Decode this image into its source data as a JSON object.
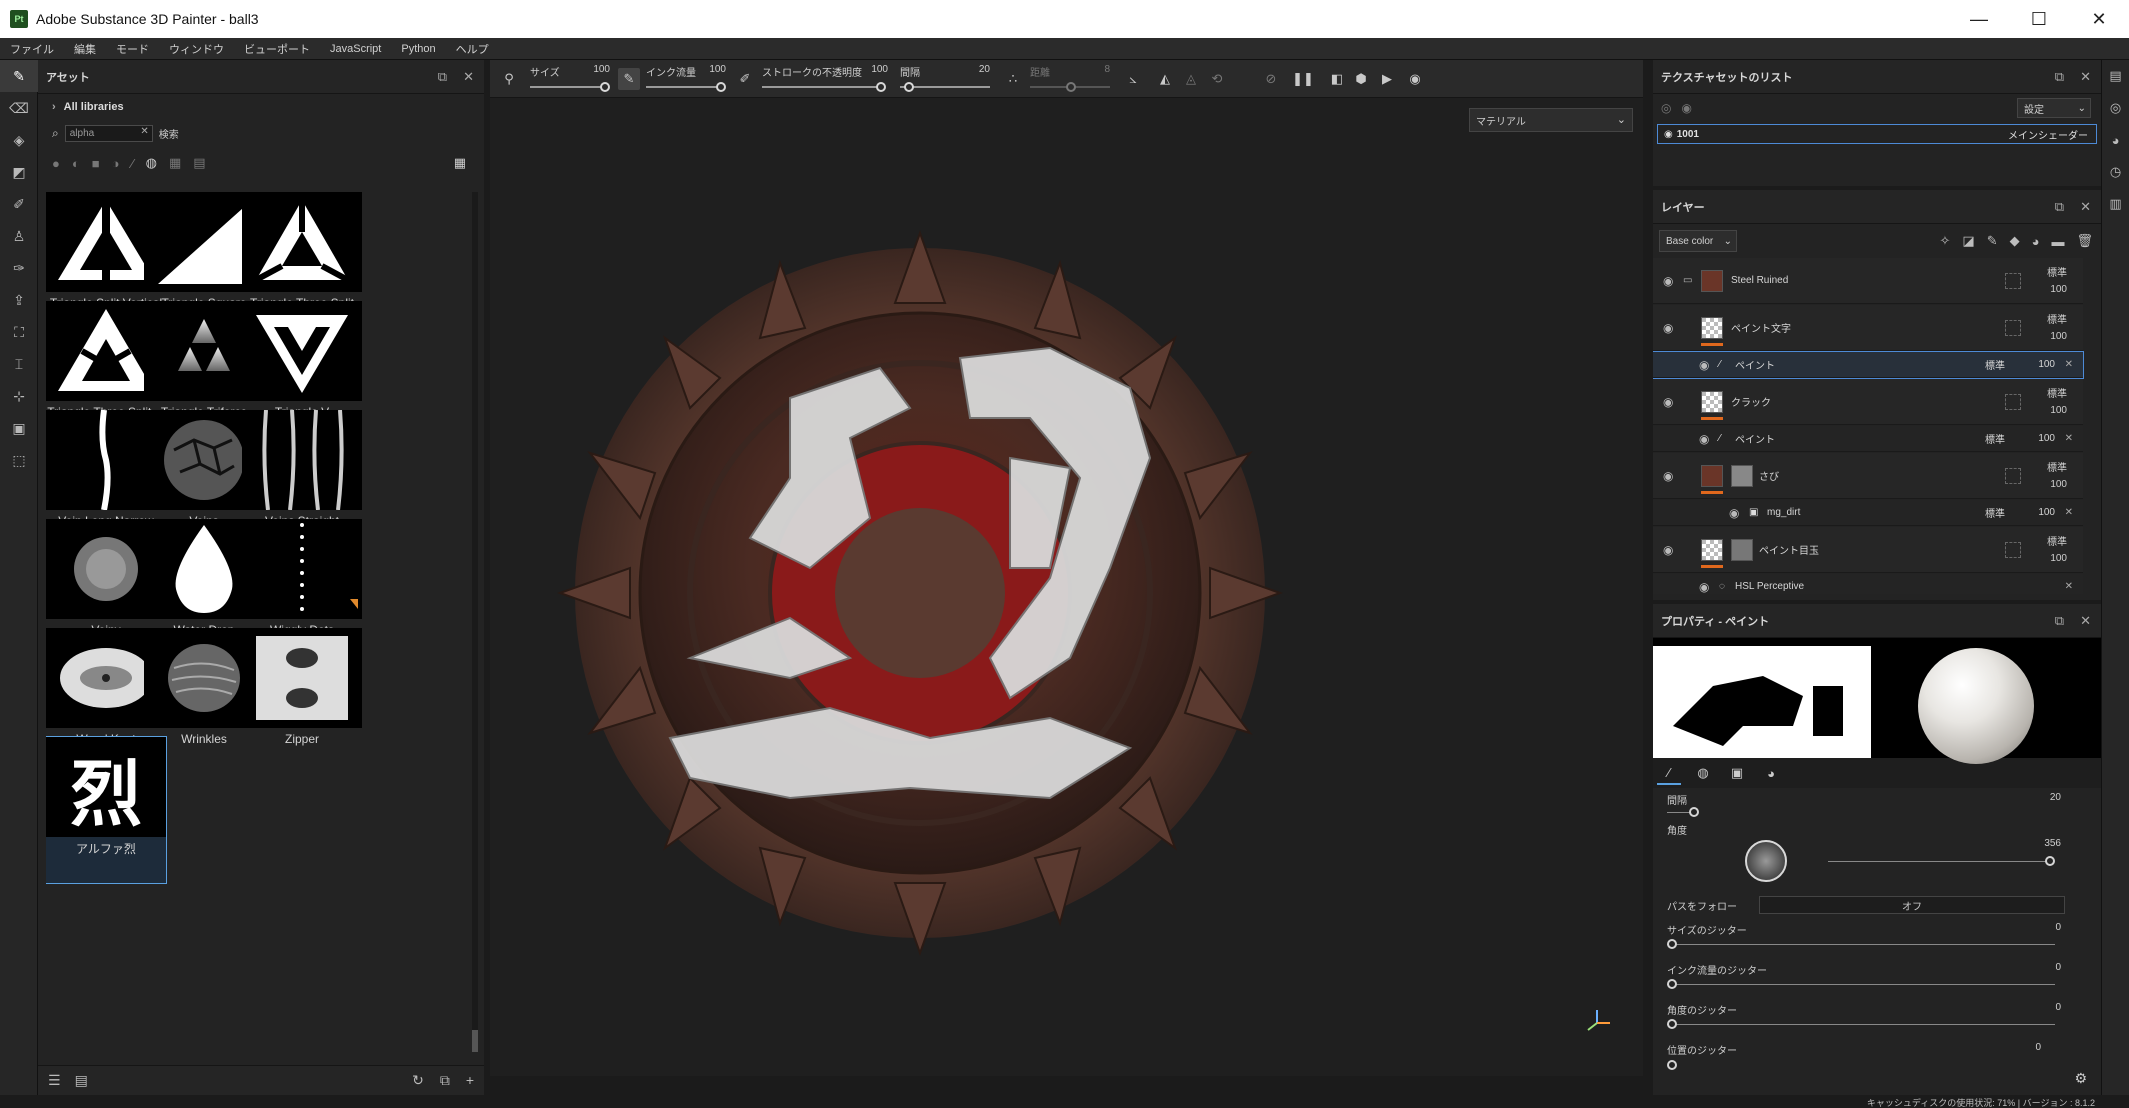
{
  "window": {
    "app_icon": "Pt",
    "title": "Adobe Substance 3D Painter - ball3",
    "controls": [
      "—",
      "☐",
      "✕"
    ]
  },
  "menu": [
    "ファイル",
    "編集",
    "モード",
    "ウィンドウ",
    "ビューポート",
    "JavaScript",
    "Python",
    "ヘルプ"
  ],
  "assets": {
    "title": "アセット",
    "library": "All libraries",
    "search_value": "alpha",
    "search_label": "検索",
    "items": [
      {
        "label": "Triangle Split Vertical",
        "icon": "triangle-split-vertical"
      },
      {
        "label": "Triangle Square",
        "icon": "triangle-square"
      },
      {
        "label": "Triangle Three Split",
        "icon": "triangle-three-split"
      },
      {
        "label": "Triangle Three Split ...",
        "icon": "triangle-three-split-2"
      },
      {
        "label": "Triangle Triforce",
        "icon": "triangle-triforce"
      },
      {
        "label": "Triangle V",
        "icon": "triangle-v"
      },
      {
        "label": "Vein Long Narrow",
        "icon": "vein-long-narrow"
      },
      {
        "label": "Veins",
        "icon": "veins"
      },
      {
        "label": "Veins Straight",
        "icon": "veins-straight"
      },
      {
        "label": "Veiny",
        "icon": "veiny"
      },
      {
        "label": "Water Drop",
        "icon": "water-drop"
      },
      {
        "label": "Wiggly Dots",
        "icon": "wiggly-dots"
      },
      {
        "label": "Wood Knot",
        "icon": "wood-knot"
      },
      {
        "label": "Wrinkles",
        "icon": "wrinkles"
      },
      {
        "label": "Zipper",
        "icon": "zipper"
      },
      {
        "label": "アルファ烈",
        "icon": "kanji-retsu",
        "glyph": "烈"
      }
    ]
  },
  "toolbar": {
    "size_label": "サイズ",
    "size_value": "100",
    "flow_label": "インク流量",
    "flow_value": "100",
    "opacity_label": "ストロークの不透明度",
    "opacity_value": "100",
    "spacing_label": "間隔",
    "spacing_value": "20",
    "distance_label": "距離",
    "distance_value": "8"
  },
  "viewport": {
    "material_select": "マテリアル"
  },
  "texture_sets": {
    "title": "テクスチャセットのリスト",
    "settings_select": "設定",
    "set_name": "1001",
    "shader": "メインシェーダー"
  },
  "layers": {
    "title": "レイヤー",
    "channel_select": "Base color",
    "rows": [
      {
        "name": "Steel Ruined",
        "blend": "標準",
        "opacity": "100",
        "kind": "folder"
      },
      {
        "name": "ペイント文字",
        "blend": "標準",
        "opacity": "100",
        "kind": "layer"
      },
      {
        "name": "ペイント",
        "blend": "標準",
        "opacity": "100",
        "kind": "effect"
      },
      {
        "name": "クラック",
        "blend": "標準",
        "opacity": "100",
        "kind": "layer"
      },
      {
        "name": "ペイント",
        "blend": "標準",
        "opacity": "100",
        "kind": "effect"
      },
      {
        "name": "さび",
        "blend": "標準",
        "opacity": "100",
        "kind": "layer"
      },
      {
        "name": "mg_dirt",
        "blend": "標準",
        "opacity": "100",
        "kind": "effect"
      },
      {
        "name": "ペイント目玉",
        "blend": "標準",
        "opacity": "100",
        "kind": "layer"
      },
      {
        "name": "HSL Perceptive",
        "blend": "",
        "opacity": "",
        "kind": "effect"
      }
    ]
  },
  "properties": {
    "title": "プロパティ - ペイント",
    "spacing_label": "間隔",
    "spacing_value": "20",
    "angle_label": "角度",
    "angle_value": "356",
    "follow_path_label": "パスをフォロー",
    "follow_path_value": "オフ",
    "size_jitter_label": "サイズのジッター",
    "size_jitter_value": "0",
    "flow_jitter_label": "インク流量のジッター",
    "flow_jitter_value": "0",
    "angle_jitter_label": "角度のジッター",
    "angle_jitter_value": "0",
    "position_jitter_label": "位置のジッター",
    "position_jitter_value": "0"
  },
  "status": {
    "text": "キャッシュディスクの使用状況:     71% | バージョン : 8.1.2"
  },
  "colors": {
    "accent": "#4d8ad6",
    "layer_tag": "#e0681d",
    "rust": "#7a3a28"
  }
}
